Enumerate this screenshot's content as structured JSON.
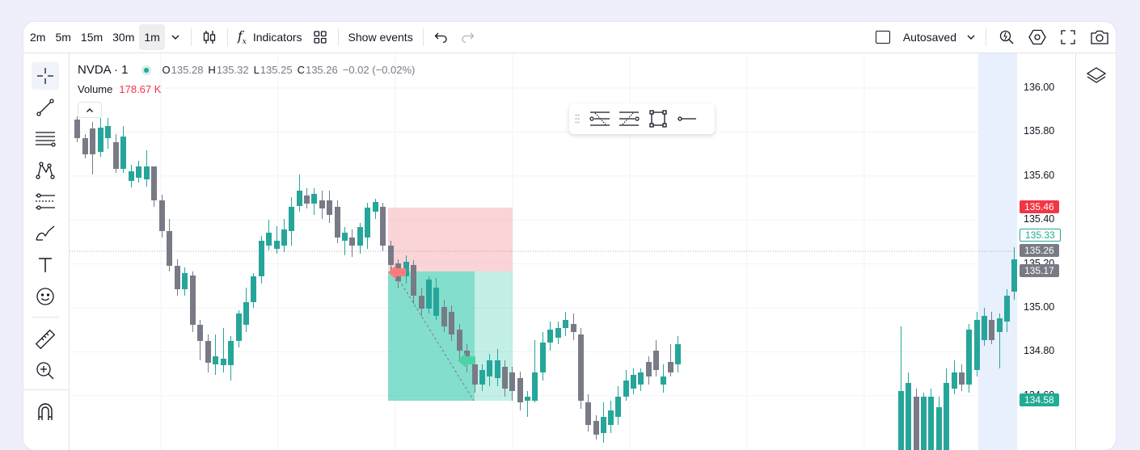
{
  "toolbar": {
    "intervals": [
      "2m",
      "5m",
      "15m",
      "30m",
      "1m"
    ],
    "active_interval": "1m",
    "indicators_label": "Indicators",
    "show_events_label": "Show events",
    "autosaved_label": "Autosaved"
  },
  "legend": {
    "symbol": "NVDA · 1",
    "status_color": "#22ab94",
    "open_label": "O",
    "open": "135.28",
    "high_label": "H",
    "high": "135.32",
    "low_label": "L",
    "low": "135.25",
    "close_label": "C",
    "close": "135.26",
    "change": "−0.02 (−0.02%)",
    "volume_label": "Volume",
    "volume_value": "178.67 K"
  },
  "price_axis": {
    "ticks": [
      "136.00",
      "135.80",
      "135.60",
      "135.40",
      "135.20",
      "135.00",
      "134.80",
      "134.60"
    ],
    "labels": [
      {
        "text": "135.46",
        "color": "#f23645",
        "style": "filled"
      },
      {
        "text": "135.33",
        "color": "#22ab94",
        "style": "outline"
      },
      {
        "text": "135.26",
        "color": "#787b86",
        "style": "filled"
      },
      {
        "text": "135.17",
        "color": "#787b86",
        "style": "filled"
      },
      {
        "text": "134.58",
        "color": "#22ab94",
        "style": "filled"
      }
    ]
  },
  "colors": {
    "up": "#26a69a",
    "down": "#787b86",
    "stop_zone": "#f7b7bd",
    "target_zone": "#26c6a8",
    "highlight": "#e8effd"
  },
  "floating_toolbar": {
    "icons": [
      "long-position-icon",
      "short-position-icon",
      "rectangle-icon",
      "horizontal-ray-icon"
    ]
  },
  "icons": {
    "top": [
      "chevron-down-icon",
      "candles-icon",
      "fx-icon",
      "grid-icon",
      "undo-icon",
      "redo-icon"
    ],
    "left": [
      "crosshair-icon",
      "trend-line-icon",
      "fib-icon",
      "pattern-icon",
      "position-icon",
      "brush-icon",
      "text-icon",
      "emoji-icon",
      "ruler-icon",
      "zoom-in-icon",
      "magnet-icon"
    ],
    "right": [
      "layers-icon"
    ]
  }
}
